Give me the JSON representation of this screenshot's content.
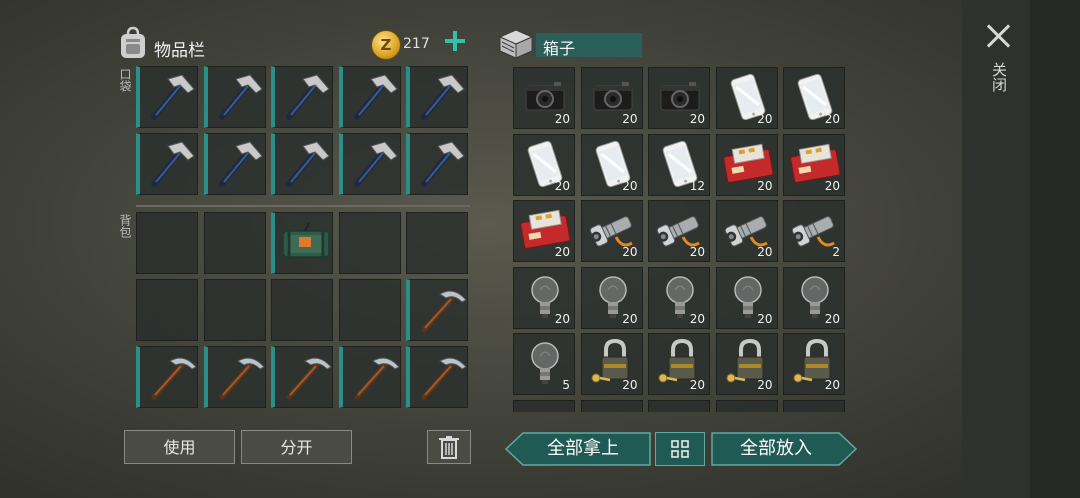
{
  "inventory": {
    "title": "物品栏",
    "coins": "217",
    "pocket_label": "口袋",
    "backpack_label": "背包",
    "pocket_items": [
      {
        "icon": "hammer-icon",
        "qty": ""
      },
      {
        "icon": "hammer-icon",
        "qty": ""
      },
      {
        "icon": "hammer-icon",
        "qty": ""
      },
      {
        "icon": "hammer-icon",
        "qty": ""
      },
      {
        "icon": "hammer-icon",
        "qty": ""
      },
      {
        "icon": "hammer-icon",
        "qty": ""
      },
      {
        "icon": "hammer-icon",
        "qty": ""
      },
      {
        "icon": "hammer-icon",
        "qty": ""
      },
      {
        "icon": "hammer-icon",
        "qty": ""
      },
      {
        "icon": "hammer-icon",
        "qty": ""
      }
    ],
    "backpack_items": [
      {
        "icon": "",
        "qty": ""
      },
      {
        "icon": "",
        "qty": ""
      },
      {
        "icon": "bomb-icon",
        "qty": ""
      },
      {
        "icon": "",
        "qty": ""
      },
      {
        "icon": "",
        "qty": ""
      },
      {
        "icon": "",
        "qty": ""
      },
      {
        "icon": "",
        "qty": ""
      },
      {
        "icon": "",
        "qty": ""
      },
      {
        "icon": "",
        "qty": ""
      },
      {
        "icon": "pickaxe-icon",
        "qty": ""
      },
      {
        "icon": "pickaxe-icon",
        "qty": ""
      },
      {
        "icon": "pickaxe-icon",
        "qty": ""
      },
      {
        "icon": "pickaxe-icon",
        "qty": ""
      },
      {
        "icon": "pickaxe-icon",
        "qty": ""
      },
      {
        "icon": "pickaxe-icon",
        "qty": ""
      }
    ],
    "use_label": "使用",
    "split_label": "分开"
  },
  "box": {
    "title": "箱子",
    "items": [
      {
        "icon": "camera-icon",
        "qty": "20"
      },
      {
        "icon": "camera-icon",
        "qty": "20"
      },
      {
        "icon": "camera-icon",
        "qty": "20"
      },
      {
        "icon": "phone-icon",
        "qty": "20"
      },
      {
        "icon": "phone-icon",
        "qty": "20"
      },
      {
        "icon": "phone-icon",
        "qty": "20"
      },
      {
        "icon": "phone-icon",
        "qty": "20"
      },
      {
        "icon": "phone-icon",
        "qty": "12"
      },
      {
        "icon": "cigarette-icon",
        "qty": "20"
      },
      {
        "icon": "cigarette-icon",
        "qty": "20"
      },
      {
        "icon": "cigarette-icon",
        "qty": "20"
      },
      {
        "icon": "flashlight-icon",
        "qty": "20"
      },
      {
        "icon": "flashlight-icon",
        "qty": "20"
      },
      {
        "icon": "flashlight-icon",
        "qty": "20"
      },
      {
        "icon": "flashlight-icon",
        "qty": "2"
      },
      {
        "icon": "bulb-icon",
        "qty": "20"
      },
      {
        "icon": "bulb-icon",
        "qty": "20"
      },
      {
        "icon": "bulb-icon",
        "qty": "20"
      },
      {
        "icon": "bulb-icon",
        "qty": "20"
      },
      {
        "icon": "bulb-icon",
        "qty": "20"
      },
      {
        "icon": "bulb-icon",
        "qty": "5"
      },
      {
        "icon": "padlock-icon",
        "qty": "20"
      },
      {
        "icon": "padlock-icon",
        "qty": "20"
      },
      {
        "icon": "padlock-icon",
        "qty": "20"
      },
      {
        "icon": "padlock-icon",
        "qty": "20"
      }
    ],
    "take_all_label": "全部拿上",
    "put_all_label": "全部放入"
  },
  "close_label": "关闭",
  "colors": {
    "accent": "#2a8f86",
    "teal_button": "#1f5a55",
    "coin": "#d8a325"
  }
}
